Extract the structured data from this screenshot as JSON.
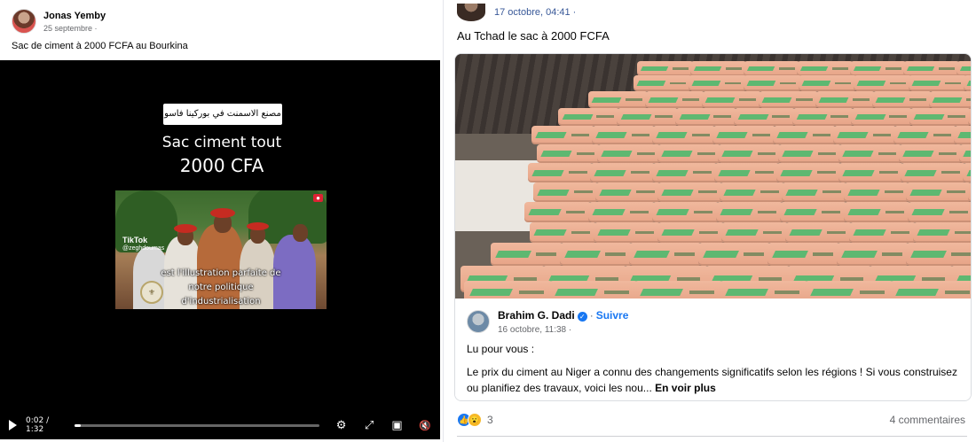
{
  "left_post": {
    "author": "Jonas Yemby",
    "date": "25 septembre ·",
    "caption": "Sac de ciment à 2000 FCFA au Bourkina",
    "video": {
      "arabic_tag": "مصنع الاسمنت في بوركينا فاسو",
      "title_line1": "Sac ciment tout",
      "title_line2": "2000 CFA",
      "tiktok_label": "TikTok",
      "tiktok_handle": "@zeghdoumas",
      "subtitle_line1": "est l'illustration parfaite de",
      "subtitle_line2": "notre politique",
      "subtitle_line3": "d'industrialisation",
      "time": "0:02 / 1:32",
      "progress": 0.0227
    }
  },
  "right_post": {
    "date": "17 octobre, 04:41 ·",
    "caption": "Au Tchad le sac à 2000 FCFA",
    "shared": {
      "author": "Brahim G. Dadi",
      "verified_glyph": "✓",
      "follow_label": "Suivre",
      "dot": "·",
      "date": "16 octobre, 11:38 ·",
      "intro": "Lu pour vous :",
      "text": "Le prix du ciment au Niger a connu des changements significatifs selon les régions ! Si vous construisez ou planifiez des travaux, voici les nou...",
      "see_more": "En voir plus"
    },
    "reaction_count": "3",
    "comments_label": "4 commentaires"
  },
  "icons": {
    "play": "play-icon",
    "settings": "⚙",
    "fullscreen": "⤢",
    "pip": "▣",
    "volume": "🔇",
    "like": "👍",
    "wow": "😮"
  },
  "colors": {
    "link_blue": "#1877f2",
    "meta_gray": "#65676b",
    "bag_orange": "#e7a487",
    "bag_green": "#5eb871"
  }
}
